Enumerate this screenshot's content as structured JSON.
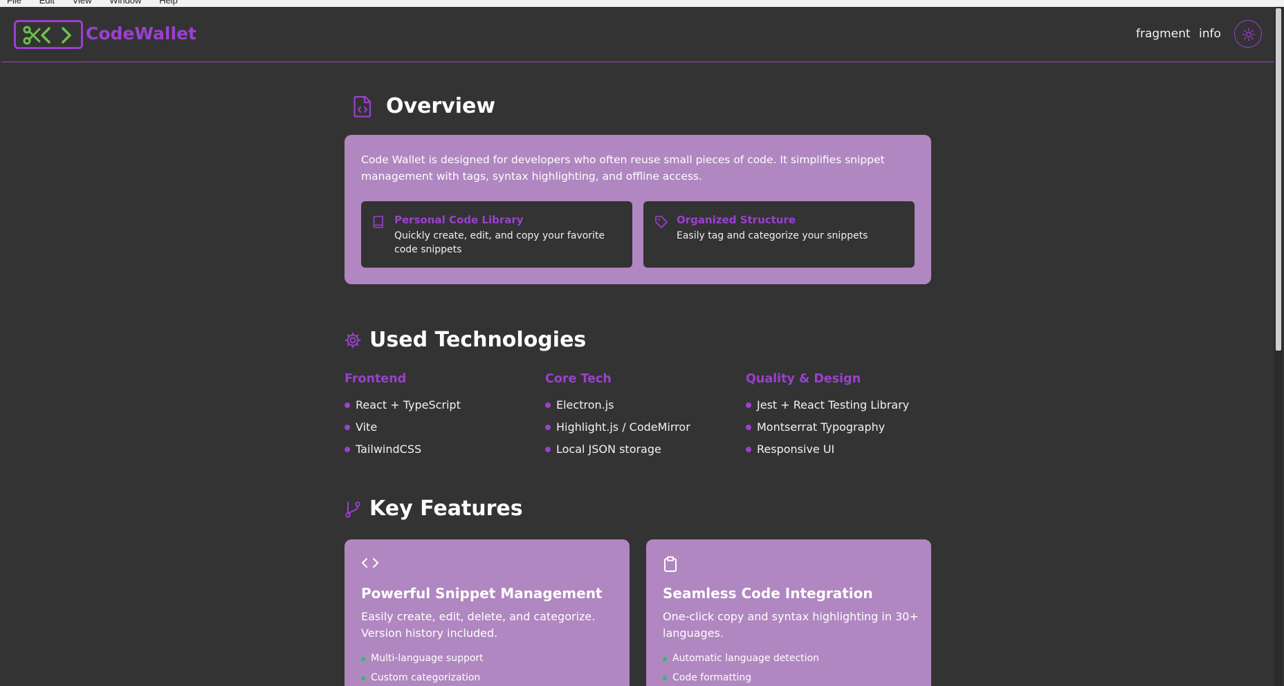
{
  "menubar": {
    "items": [
      "File",
      "Edit",
      "View",
      "Window",
      "Help"
    ]
  },
  "header": {
    "app_name": "CodeWallet",
    "nav": [
      "fragment",
      "info"
    ],
    "theme_icon": "sun-icon"
  },
  "overview": {
    "title": "Overview",
    "description": "Code Wallet is designed for developers who often reuse small pieces of code. It simplifies snippet management with tags, syntax highlighting, and offline access.",
    "cards": [
      {
        "icon": "book-icon",
        "title": "Personal Code Library",
        "description": "Quickly create, edit, and copy your favorite code snippets"
      },
      {
        "icon": "tag-icon",
        "title": "Organized Structure",
        "description": "Easily tag and categorize your snippets"
      }
    ]
  },
  "technologies": {
    "title": "Used Technologies",
    "columns": [
      {
        "title": "Frontend",
        "items": [
          "React + TypeScript",
          "Vite",
          "TailwindCSS"
        ]
      },
      {
        "title": "Core Tech",
        "items": [
          "Electron.js",
          "Highlight.js / CodeMirror",
          "Local JSON storage"
        ]
      },
      {
        "title": "Quality & Design",
        "items": [
          "Jest + React Testing Library",
          "Montserrat Typography",
          "Responsive UI"
        ]
      }
    ]
  },
  "features": {
    "title": "Key Features",
    "cards": [
      {
        "icon": "code-icon",
        "title": "Powerful Snippet Management",
        "description": "Easily create, edit, delete, and categorize. Version history included.",
        "items": [
          "Multi-language support",
          "Custom categorization"
        ]
      },
      {
        "icon": "clipboard-icon",
        "title": "Seamless Code Integration",
        "description": "One-click copy and syntax highlighting in 30+ languages.",
        "items": [
          "Automatic language detection",
          "Code formatting"
        ]
      }
    ]
  },
  "colors": {
    "accent": "#9b40d0",
    "card": "#b087c0",
    "bg": "#333333",
    "logo_green": "#6cc24a",
    "bullet_green": "#22c55e"
  }
}
